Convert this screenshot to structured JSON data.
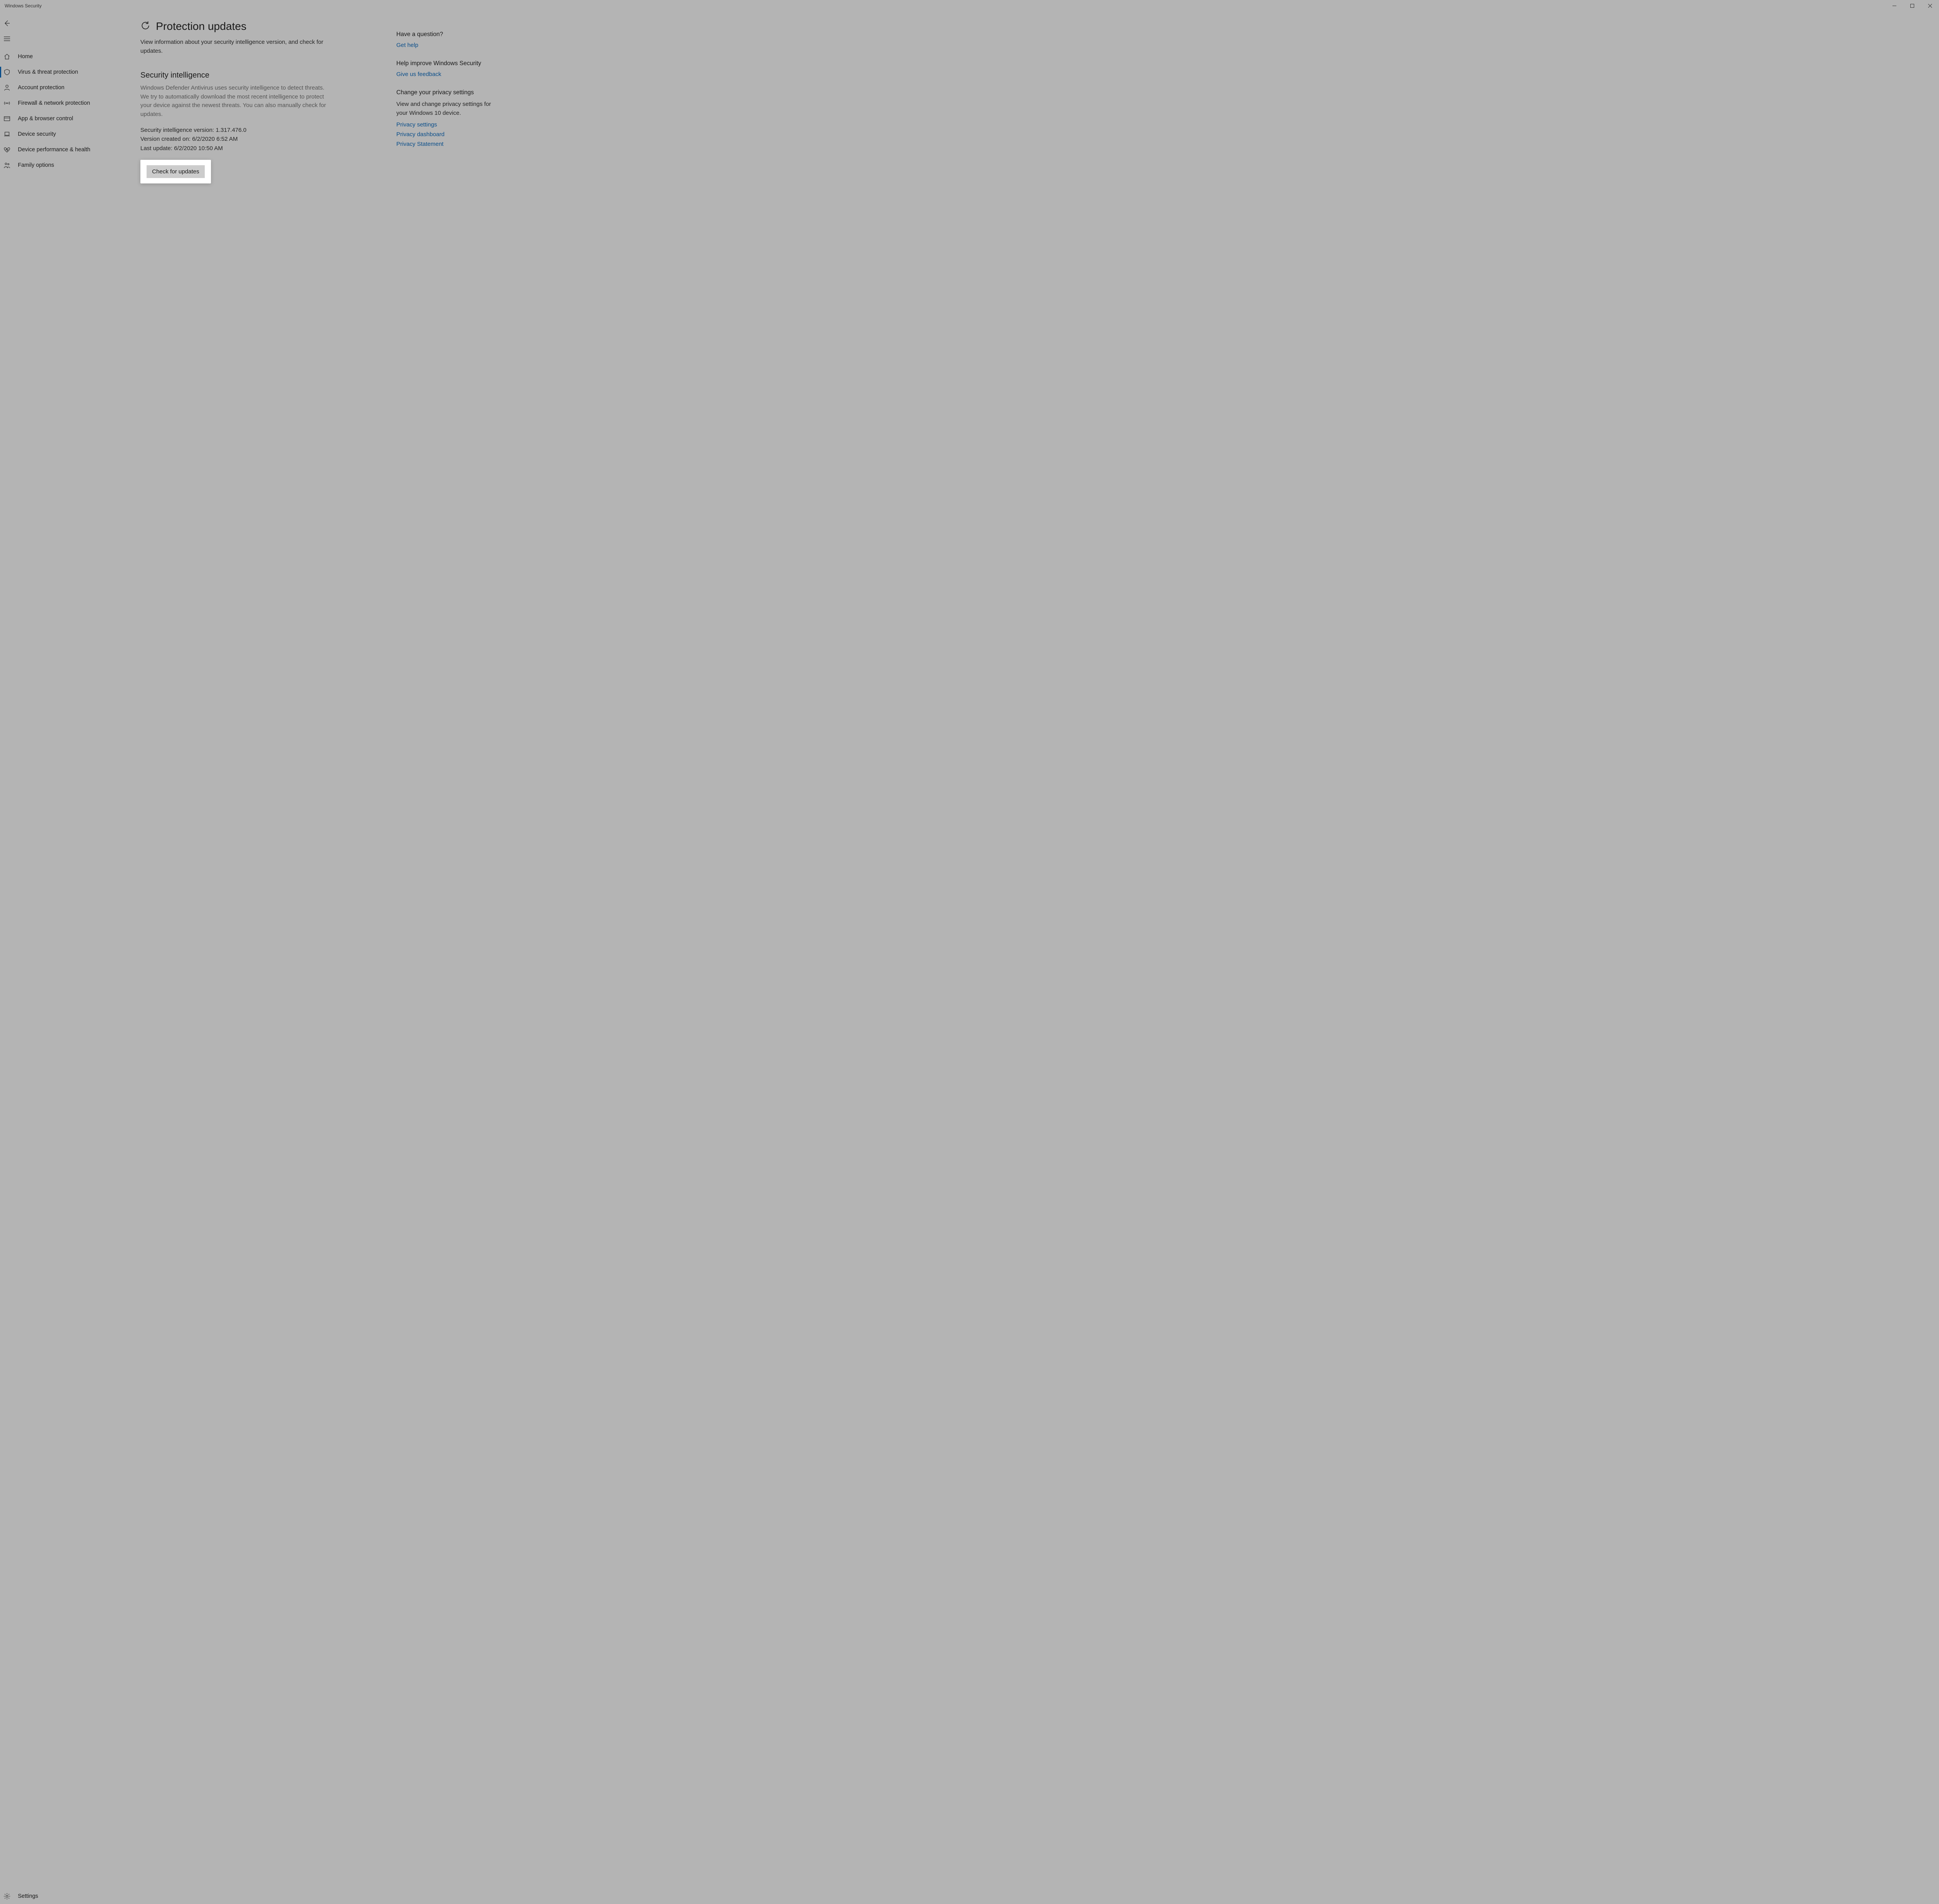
{
  "window": {
    "title": "Windows Security"
  },
  "sidebar": {
    "items": [
      {
        "label": "Home"
      },
      {
        "label": "Virus & threat protection"
      },
      {
        "label": "Account protection"
      },
      {
        "label": "Firewall & network protection"
      },
      {
        "label": "App & browser control"
      },
      {
        "label": "Device security"
      },
      {
        "label": "Device performance & health"
      },
      {
        "label": "Family options"
      }
    ],
    "settings_label": "Settings"
  },
  "main": {
    "title": "Protection updates",
    "subtitle": "View information about your security intelligence version, and check for updates.",
    "section_title": "Security intelligence",
    "section_desc": "Windows Defender Antivirus uses security intelligence to detect threats. We try to automatically download the most recent intelligence to protect your device against the newest threats. You can also manually check for updates.",
    "version_line": "Security intelligence version: 1.317.476.0",
    "created_line": "Version created on: 6/2/2020 6:52 AM",
    "update_line": "Last update: 6/2/2020 10:50 AM",
    "check_button": "Check for updates"
  },
  "aside": {
    "question_title": "Have a question?",
    "get_help": "Get help",
    "improve_title": "Help improve Windows Security",
    "feedback": "Give us feedback",
    "privacy_title": "Change your privacy settings",
    "privacy_desc": "View and change privacy settings for your Windows 10 device.",
    "privacy_links": [
      "Privacy settings",
      "Privacy dashboard",
      "Privacy Statement"
    ]
  }
}
